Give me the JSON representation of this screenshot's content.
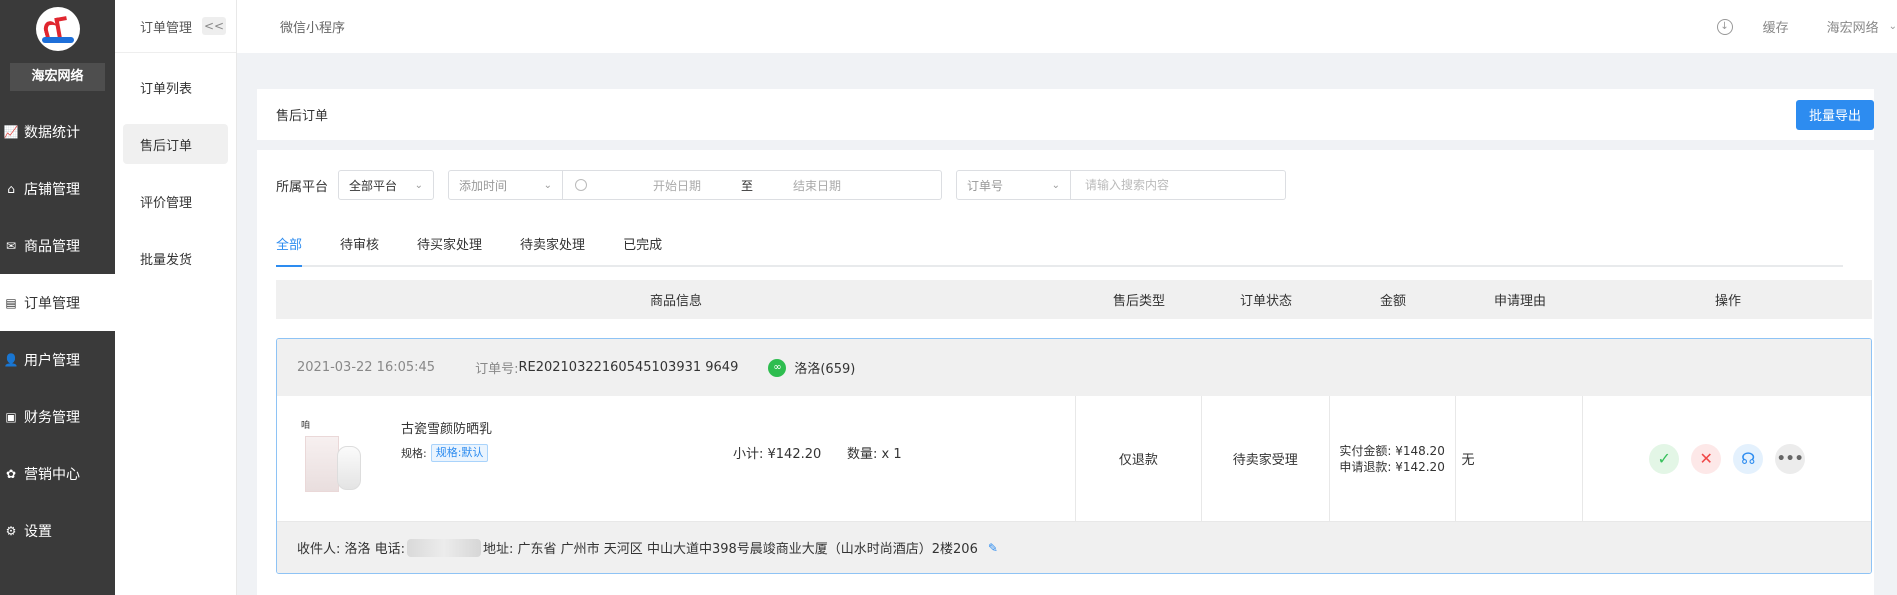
{
  "brand": {
    "name": "海宏网络"
  },
  "sidebar": {
    "items": [
      {
        "label": "数据统计",
        "icon": "chart-icon"
      },
      {
        "label": "店铺管理",
        "icon": "store-icon"
      },
      {
        "label": "商品管理",
        "icon": "goods-icon"
      },
      {
        "label": "订单管理",
        "icon": "order-icon"
      },
      {
        "label": "用户管理",
        "icon": "user-icon"
      },
      {
        "label": "财务管理",
        "icon": "finance-icon"
      },
      {
        "label": "营销中心",
        "icon": "marketing-icon"
      },
      {
        "label": "设置",
        "icon": "settings-icon"
      }
    ]
  },
  "subnav": {
    "title": "订单管理",
    "collapse": "<<",
    "items": [
      "订单列表",
      "售后订单",
      "评价管理",
      "批量发货"
    ]
  },
  "topbar": {
    "crumb": "微信小程序",
    "cache": "缓存",
    "user": "海宏网络"
  },
  "page": {
    "title": "售后订单",
    "export_label": "批量导出"
  },
  "filters": {
    "platform_label": "所属平台",
    "platform_value": "全部平台",
    "time_type": "添加时间",
    "start_placeholder": "开始日期",
    "to": "至",
    "end_placeholder": "结束日期",
    "search_type": "订单号",
    "search_placeholder": "请输入搜索内容"
  },
  "tabs": [
    "全部",
    "待审核",
    "待买家处理",
    "待卖家处理",
    "已完成"
  ],
  "columns": [
    "商品信息",
    "售后类型",
    "订单状态",
    "金额",
    "申请理由",
    "操作"
  ],
  "order": {
    "time": "2021-03-22 16:05:45",
    "order_no_label": "订单号:",
    "order_no": "RE20210322160545103931 9649",
    "buyer": "洛洛(659)",
    "product_name": "古瓷雪颜防晒乳",
    "spec_label": "规格:",
    "spec_value": "规格:默认",
    "subtotal": "小计: ¥142.20",
    "quantity": "数量: x 1",
    "after_sale_type": "仅退款",
    "status": "待卖家受理",
    "paid": "实付金额: ¥148.20",
    "refund": "申请退款: ¥142.20",
    "reason": "无",
    "thumb_text": "咱",
    "receiver_label": "收件人: 洛洛 电话:",
    "address": "地址: 广东省 广州市 天河区 中山大道中398号晨竣商业大厦（山水时尚酒店）2楼206"
  }
}
